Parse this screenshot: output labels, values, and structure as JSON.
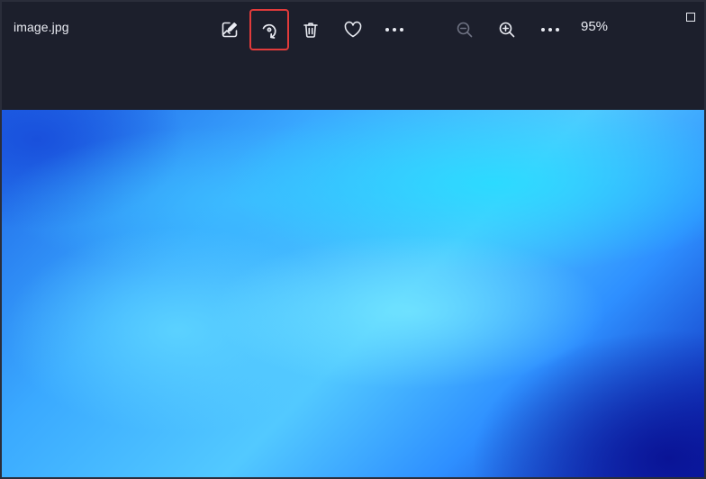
{
  "app": {
    "file_name": "image.jpg",
    "zoom_level": "95%"
  },
  "toolbar": {
    "edit": {
      "icon": "edit-image-icon"
    },
    "rotate": {
      "icon": "rotate-icon",
      "highlighted": true,
      "highlight_color": "#e23b3b"
    },
    "delete": {
      "icon": "trash-icon"
    },
    "favorite": {
      "icon": "heart-icon"
    },
    "more": {
      "icon": "more-horizontal-icon"
    },
    "zoom_out": {
      "icon": "zoom-out-icon",
      "enabled": false
    },
    "zoom_in": {
      "icon": "zoom-in-icon"
    },
    "view_more": {
      "icon": "more-horizontal-icon"
    }
  },
  "window": {
    "maximize": {
      "icon": "maximize-icon"
    }
  },
  "theme": {
    "titlebar_bg": "#1c1f2c",
    "text_color": "#e9ebf2",
    "disabled_color": "#6e7282"
  }
}
